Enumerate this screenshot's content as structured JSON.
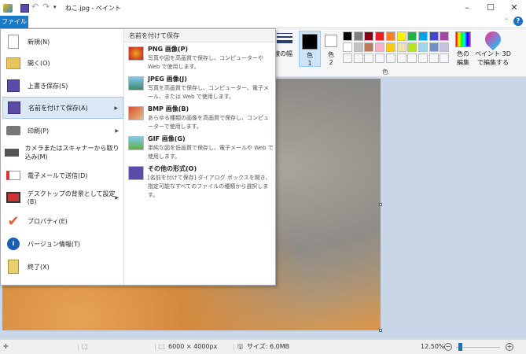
{
  "title": "ねこ.jpg - ペイント",
  "file_tab": "ファイル",
  "menu": {
    "items": [
      {
        "label": "新規(N)",
        "icon": "new-file-icon"
      },
      {
        "label": "開く(O)",
        "icon": "open-folder-icon"
      },
      {
        "label": "上書き保存(S)",
        "icon": "save-icon"
      },
      {
        "label": "名前を付けて保存(A)",
        "icon": "save-as-icon",
        "submenu": true,
        "selected": true
      },
      {
        "label": "印刷(P)",
        "icon": "printer-icon",
        "submenu": true
      },
      {
        "label": "カメラまたはスキャナーから取り込み(M)",
        "icon": "scanner-icon"
      },
      {
        "label": "電子メールで送信(D)",
        "icon": "email-icon"
      },
      {
        "label": "デスクトップの背景として設定(B)",
        "icon": "desktop-icon",
        "submenu": true
      },
      {
        "label": "プロパティ(E)",
        "icon": "checkmark-icon"
      },
      {
        "label": "バージョン情報(T)",
        "icon": "info-icon"
      },
      {
        "label": "終了(X)",
        "icon": "exit-icon"
      }
    ],
    "submenu_title": "名前を付けて保存",
    "submenu": [
      {
        "label": "PNG 画像(P)",
        "desc": "写真や図を高画質で保存し、コンピューターや Web で使用します。"
      },
      {
        "label": "JPEG 画像(J)",
        "desc": "写真を高画質で保存し、コンピューター、電子メール、または Web で使用します。"
      },
      {
        "label": "BMP 画像(B)",
        "desc": "あらゆる種類の画像を高画質で保存し、コンピューターで使用します。"
      },
      {
        "label": "GIF 画像(G)",
        "desc": "単純な図を低画質で保存し、電子メールや Web で使用します。"
      },
      {
        "label": "その他の形式(O)",
        "desc": "[名前を付けて保存] ダイアログ ボックスを開き、指定可能なすべてのファイルの種類から選択します。"
      }
    ]
  },
  "ribbon": {
    "line_width": "線の幅",
    "color1": "色\n1",
    "color1_a": "色",
    "color1_b": "1",
    "color2_a": "色",
    "color2_b": "2",
    "edit_colors_a": "色の",
    "edit_colors_b": "編集",
    "paint3d_a": "ペイント 3D",
    "paint3d_b": "で編集する",
    "group_label": "色",
    "palette": [
      "#000000",
      "#7f7f7f",
      "#880015",
      "#ed1c24",
      "#ff7f27",
      "#fff200",
      "#22b14c",
      "#00a2e8",
      "#3f48cc",
      "#a349a4",
      "#ffffff",
      "#c3c3c3",
      "#b97a57",
      "#ffaec9",
      "#ffc90e",
      "#efe4b0",
      "#b5e61d",
      "#99d9ea",
      "#7092be",
      "#c8bfe7"
    ]
  },
  "status": {
    "dimensions": "6000 × 4000px",
    "size": "サイズ: 6.0MB",
    "zoom": "12.50%",
    "zoom_fraction": 0.125
  }
}
